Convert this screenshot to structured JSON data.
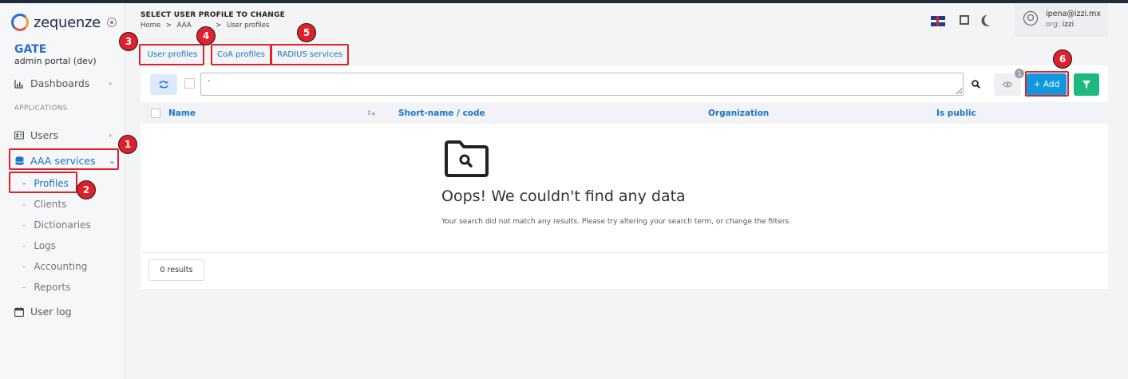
{
  "app": {
    "brand_name": "zequenze",
    "portal_title": "GATE",
    "portal_subtitle": "admin portal (dev)"
  },
  "sidebar": {
    "dashboards": "Dashboards",
    "section_label": "APPLICATIONS",
    "users": "Users",
    "aaa": "AAA services",
    "sub_items": [
      "Profiles",
      "Clients",
      "Dictionaries",
      "Logs",
      "Accounting",
      "Reports"
    ],
    "user_log": "User log"
  },
  "header": {
    "title": "SELECT USER PROFILE TO CHANGE",
    "breadcrumb": [
      "Home",
      ">",
      "AAA",
      ">",
      "User profiles"
    ],
    "user_email": "ipena@izzi.mx",
    "user_org_label": "org:",
    "user_org": "izzi"
  },
  "tabs": [
    "User profiles",
    "CoA profiles",
    "RADIUS services"
  ],
  "toolbar": {
    "search_value": ".",
    "eye_badge": "1",
    "add_label": "+ Add"
  },
  "table": {
    "columns": [
      "Name",
      "Short-name / code",
      "Organization",
      "Is public"
    ]
  },
  "empty": {
    "title": "Oops! We couldn't find any data",
    "message": "Your search did not match any results. Please try altering your search term, or change the filters."
  },
  "footer": {
    "results": "0 results"
  },
  "annotations": [
    "1",
    "2",
    "3",
    "4",
    "5",
    "6"
  ],
  "colors": {
    "accent": "#1a73c8",
    "add": "#1196e0",
    "filter": "#1eb980",
    "highlight": "#e0202a"
  }
}
